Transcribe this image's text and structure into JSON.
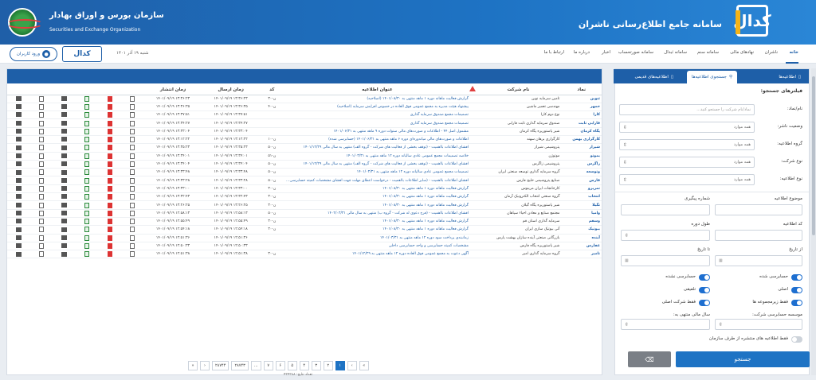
{
  "header": {
    "codal_logo": "کدال",
    "system_title": "سامانه جامع اطلاع‌رسانی ناشران",
    "org_title": "سازمان بورس و اوراق بهادار",
    "org_subtitle": "Securities and Exchange Organization"
  },
  "nav": {
    "items": [
      "خانه",
      "ناشران",
      "نهادهای مالی",
      "سامانه سنم",
      "سامانه ثبدال",
      "سامانه صورتحساب",
      "اخبار",
      "درباره ما",
      "ارتباط با ما"
    ],
    "date": "شنبه ۱۹ آذر ۱۴۰۱",
    "codal_button": "کدال",
    "login_button": "ورود کاربران"
  },
  "filter": {
    "tabs": [
      "اطلاعیه‌ها",
      "جستجوی اطلاعیه‌ها",
      "اطلاعیه‌های قدیمی"
    ],
    "title": "فیلترهای جستجو:",
    "company_label": "نام/نماد:",
    "company_placeholder": "نماد/نام شرکت را جستجو کنید...",
    "status_label": "وضعیت ناشر:",
    "status_value": "همه موارد",
    "group_label": "گروه اطلاعیه:",
    "group_value": "همه موارد",
    "type_label": "نوع شرکت:",
    "type_value": "همه موارد",
    "letter_label": "نوع اطلاعیه:",
    "letter_value": "همه موارد",
    "subject_label": "موضوع اطلاعیه",
    "tracking_label": "شماره پیگیری",
    "code_label": "کد اطلاعیه",
    "period_label": "طول دوره",
    "from_label": "از تاریخ",
    "to_label": "تا تاریخ",
    "audited": "حسابرسی شده",
    "not_audited": "حسابرسی نشده",
    "main": "اصلی",
    "consolidated": "تلفیقی",
    "subsidiary": "فقط زیرمجموعه ها",
    "parent": "فقط شرکت اصلی",
    "auditor_label": "موسسه حسابرسی شرکت:",
    "fiscal_label": "سال مالی منتهی به:",
    "org_only": "فقط اطلاعیه های منتشره از طرف سازمان",
    "search_button": "جستجو"
  },
  "table": {
    "columns": [
      "نماد",
      "نام شرکت",
      "عنوان اطلاعیه",
      "کد",
      "زمان ارسال",
      "زمان انتشار"
    ],
    "rows": [
      {
        "sym": "ثنوین",
        "comp": "تامین سرمایه نوین",
        "title": "گزارش فعالیت ماهانه دوره ۱ ماهه منتهی به ۱۴۰۱/۰۸/۳۰ (اصلاحیه)",
        "code": "ن-۳۰",
        "sent": "۱۴۰۱/۰۹/۱۹ ۱۳:۳۶:۲۳",
        "pub": "۱۴۰۱/۰۹/۱۹ ۱۳:۳۶:۲۳"
      },
      {
        "sym": "خمهر",
        "comp": "مهندسی تعمیر ماشین",
        "title": "پیشنهاد هیئت مدیره به مجمع عمومی فوق العاده در خصوص افزایش سرمایه (اصلاحیه)",
        "code": "ن-۴۰",
        "sent": "۱۴۰۱/۰۹/۱۹ ۱۳:۳۶:۳۵",
        "pub": "۱۴۰۱/۰۹/۱۹ ۱۳:۳۶:۳۵"
      },
      {
        "sym": "کارا",
        "comp": "نوع دوم کارا",
        "title": "تصمیمات مجمع صندوق سرمایه گذاری",
        "code": "",
        "sent": "۱۴۰۱/۰۹/۱۹ ۱۳:۳۷:۵۱",
        "pub": "۱۴۰۱/۰۹/۱۹ ۱۳:۳۷:۵۱"
      },
      {
        "sym": "فارابی ثابت",
        "comp": "صندوق سرمایه گذاری ثابت فارابی",
        "title": "تصمیمات مجمع صندوق سرمایه گذاری",
        "code": "",
        "sent": "۱۴۰۱/۰۹/۱۹ ۱۳:۳۴:۲۷",
        "pub": "۱۴۰۱/۰۹/۱۹ ۱۳:۳۴:۲۷"
      },
      {
        "sym": "پگاه کرمان",
        "comp": "شیر پاستوریزه پگاه کرمان",
        "title": "مشمول اصل ۴۴ - اطلاعات و صورت‌های مالی سنوات دوره ۹ ماهه منتهی به ۱۴۰۱/۰۶/۳۱",
        "code": "",
        "sent": "۱۴۰۱/۰۹/۱۹ ۱۳:۳۳:۰۴",
        "pub": "۱۴۰۱/۰۹/۱۹ ۱۳:۳۳:۰۴"
      },
      {
        "sym": "کارگزاری بهمن",
        "comp": "کارگزاری برهان سهند",
        "title": "اطلاعات و صورت‌های مالی میاندوره‌ای دوره ۶ ماهه منتهی به ۱۴۰۱/۰۶/۳۱ (حسابرسی شده)",
        "code": "ن-۱۰",
        "sent": "۱۴۰۱/۰۹/۱۹ ۱۳:۱۲:۲۲",
        "pub": "۱۴۰۱/۰۹/۱۹ ۱۳:۱۲:۲۲"
      },
      {
        "sym": "شیراز",
        "comp": "پتروشیمی شیراز",
        "title": "افشای اطلاعات بااهمیت - (توقف بخشی از فعالیت های شرکت - گروه الف) منتهی به سال مالی ۱۴۰۱/۱۲/۲۹",
        "code": "ن-۵۰",
        "sent": "۱۴۰۱/۰۹/۱۹ ۱۳:۳۵:۲۳",
        "pub": "۱۴۰۱/۰۹/۱۹ ۱۳:۳۵:۲۳"
      },
      {
        "sym": "بموتو",
        "comp": "موتوژن",
        "title": "خلاصه تصمیمات مجمع عمومی عادی سالیانه دوره ۱۲ ماهه منتهی به ۱۴۰۱/۰۳/۳۱",
        "code": "ن-۵۱",
        "sent": "۱۴۰۱/۰۹/۱۹ ۱۳:۳۴:۰۱",
        "pub": "۱۴۰۱/۰۹/۱۹ ۱۳:۳۴:۰۱"
      },
      {
        "sym": "زاگرس",
        "comp": "پتروشیمی زاگرس",
        "title": "افشای اطلاعات بااهمیت - (توقف بخشی از فعالیت های شرکت - گروه الف) منتهی به سال مالی ۱۴۰۱/۱۲/۲۹",
        "code": "ن-۵۰",
        "sent": "۱۴۰۱/۰۹/۱۹ ۱۳:۳۴:۰۴",
        "pub": "۱۴۰۱/۰۹/۱۹ ۱۳:۳۴:۰۴"
      },
      {
        "sym": "وتوسعه",
        "comp": "گروه سرمایه گذاری توسعه صنعتی ایران",
        "title": "تصمیمات مجمع عمومی عادی سالیانه دوره ۱۲ ماهه منتهی به ۱۴۰۱/۰۳/۳۱",
        "code": "ن-۵۰",
        "sent": "۱۴۰۱/۰۹/۱۹ ۱۳:۳۳:۴۸",
        "pub": "۱۴۰۱/۰۹/۱۹ ۱۳:۳۳:۴۸"
      },
      {
        "sym": "فارس",
        "comp": "صنایع پتروشیمی خلیج فارس",
        "title": "افشای اطلاعات بااهمیت - (سایر اطلاعات بااهمیت - درخواست اعطای مهلت جهت افشای مشخصات کمیته حسابرسی - گروه ب) منتهی به سال مالی ۱۴۰۱/۰۳/۳۱",
        "code": "ن-۵۰",
        "sent": "۱۴۰۱/۰۹/۱۹ ۱۳:۳۳:۲۸",
        "pub": "۱۴۰۱/۰۹/۱۹ ۱۳:۳۳:۲۸"
      },
      {
        "sym": "تمریزو",
        "comp": "کارخانجات ایران مرینوس",
        "title": "گزارش فعالیت ماهانه دوره ۱ ماهه منتهی به ۱۴۰۱/۰۸/۳۰",
        "code": "ن-۳۰",
        "sent": "۱۴۰۱/۰۹/۱۹ ۱۳:۳۳:۰۰",
        "pub": "۱۴۰۱/۰۹/۱۹ ۱۳:۳۳:۰۰"
      },
      {
        "sym": "انتخاب",
        "comp": "گروه صنعتی انتخاب الکترونیک آرمان",
        "title": "گزارش فعالیت ماهانه دوره ۱ ماهه منتهی به ۱۴۰۱/۰۸/۳۰",
        "code": "ن-۳۰",
        "sent": "۱۴۰۱/۰۹/۱۹ ۱۳:۳۲:۴۳",
        "pub": "۱۴۰۱/۰۹/۱۹ ۱۳:۳۲:۴۳"
      },
      {
        "sym": "نگیلا",
        "comp": "شیر پاستوریزه پگاه گیلان",
        "title": "گزارش فعالیت ماهانه دوره ۱ ماهه منتهی به ۱۴۰۱/۰۸/۳۰",
        "code": "ن-۳۰",
        "sent": "۱۴۰۱/۰۹/۱۹ ۱۳:۲۶:۲۵",
        "pub": "۱۴۰۱/۰۹/۱۹ ۱۳:۲۶:۲۵"
      },
      {
        "sym": "وامیا",
        "comp": "مجتمع صنایع و معادن احیاء سپاهان",
        "title": "افشای اطلاعات بااهمیت - (فرج دعوی له شرکت - گروه ب) منتهی به سال مالی ۱۴۰۲/۰۳/۳۱",
        "code": "ن-۵۰",
        "sent": "۱۴۰۱/۰۹/۱۹ ۱۲:۵۸:۱۳",
        "pub": "۱۴۰۱/۰۹/۱۹ ۱۲:۵۸:۱۳"
      },
      {
        "sym": "وسقم",
        "comp": "سرمایه گذاری استان قم",
        "title": "گزارش فعالیت ماهانه دوره ۱ ماهه منتهی به ۱۴۰۱/۰۸/۳۰",
        "code": "ن-۳۰",
        "sent": "۱۴۰۱/۰۹/۱۹ ۱۲:۵۵:۴۹",
        "pub": "۱۴۰۱/۰۹/۱۹ ۱۲:۵۵:۴۹"
      },
      {
        "sym": "ببوتیک",
        "comp": "آتی بیوتیک سازی ایران",
        "title": "گزارش فعالیت ماهانه دوره ۱ ماهه منتهی به ۱۴۰۱/۰۸/۳۰",
        "code": "ن-۳۰",
        "sent": "۱۴۰۱/۰۹/۱۹ ۱۲:۵۴:۱۸",
        "pub": "۱۴۰۱/۰۹/۱۹ ۱۲:۵۴:۱۸"
      },
      {
        "sym": "آبنده",
        "comp": "بازرگانی صنعتی آینده سازان بهشت پارس",
        "title": "زمانبندی پرداخت سود دوره ۱۲ ماهه منتهی به ۱۴۰۱/۰۳/۳۱",
        "code": "",
        "sent": "۱۴۰۱/۰۹/۱۹ ۱۲:۵۱:۳۶",
        "pub": "۱۴۰۱/۰۹/۱۹ ۱۲:۵۱:۳۶"
      },
      {
        "sym": "غفارس",
        "comp": "شیر پاستوریزه پگاه فارس",
        "title": "مشخصات کمیته حسابرسی و واحد حسابرسی داخلی",
        "code": "",
        "sent": "۱۴۰۱/۰۹/۱۹ ۱۲:۵۰:۳۳",
        "pub": "۱۴۰۱/۰۹/۱۹ ۱۲:۵۰:۳۳"
      },
      {
        "sym": "تامیر",
        "comp": "گروه سرمایه گذاری امیر",
        "title": "آگهی دعوت به مجمع عمومی فوق العاده دوره ۱۲ ماهه منتهی به ۱۴۰۱/۱۲/۲۹",
        "code": "ن-۳۰",
        "sent": "۱۴۰۱/۰۹/۱۹ ۱۲:۵۱:۳۸",
        "pub": "۱۴۰۱/۰۹/۱۹ ۱۲:۵۱:۳۸"
      }
    ]
  },
  "pager": {
    "pages": [
      "«",
      "‹",
      "۱",
      "۲",
      "۳",
      "۴",
      "۵",
      "۶",
      "۷",
      "...",
      "۲۸۷۴۳",
      "۲۸۷۴۴",
      "›",
      "»"
    ],
    "result_count": "تعداد نتایج: ۴۳۴۳۸۸"
  },
  "icons": [
    "document-icon",
    "pdf-icon",
    "excel-icon",
    "attachment-icon",
    "warning-icon",
    "search-icon",
    "lock-icon",
    "eraser-icon"
  ],
  "colors": {
    "primary": "#1e5fa8",
    "accent": "#1e73c4",
    "pdf": "#dd3333",
    "warn": "#e04040"
  }
}
